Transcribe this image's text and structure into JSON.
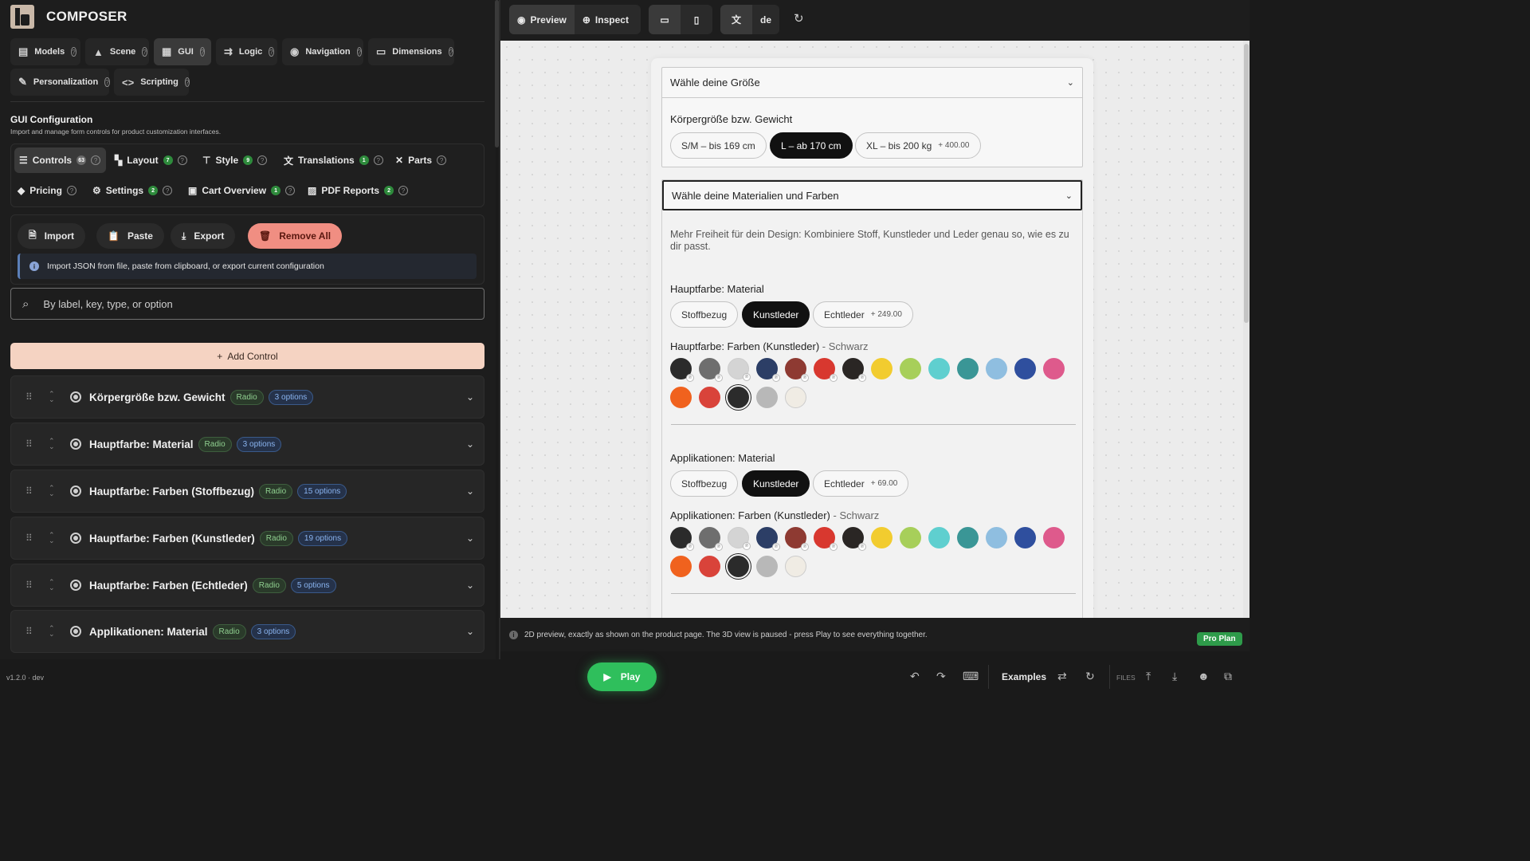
{
  "app": {
    "title": "COMPOSER",
    "version": "v1.2.0 · dev"
  },
  "main_tabs": [
    {
      "label": "Models",
      "icon": "database-icon"
    },
    {
      "label": "Scene",
      "icon": "mountain-icon"
    },
    {
      "label": "GUI",
      "icon": "grid-icon",
      "active": true
    },
    {
      "label": "Logic",
      "icon": "logic-icon"
    },
    {
      "label": "Navigation",
      "icon": "compass-icon"
    },
    {
      "label": "Dimensions",
      "icon": "ruler-icon"
    },
    {
      "label": "Personalization",
      "icon": "brush-icon"
    },
    {
      "label": "Scripting",
      "icon": "code-icon"
    }
  ],
  "gui_config": {
    "title": "GUI Configuration",
    "subtitle": "Import and manage form controls for product customization interfaces."
  },
  "sub_tabs": [
    {
      "label": "Controls",
      "count": "63",
      "active": true
    },
    {
      "label": "Layout",
      "count": "7"
    },
    {
      "label": "Style",
      "count": "9"
    },
    {
      "label": "Translations",
      "count": "1"
    },
    {
      "label": "Parts",
      "count": ""
    },
    {
      "label": "Pricing",
      "count": ""
    },
    {
      "label": "Settings",
      "count": "2"
    },
    {
      "label": "Cart Overview",
      "count": "1"
    },
    {
      "label": "PDF Reports",
      "count": "2"
    }
  ],
  "toolbar": {
    "import_label": "Import",
    "paste_label": "Paste",
    "export_label": "Export",
    "remove_all_label": "Remove All",
    "info_text": "Import JSON from file, paste from clipboard, or export current configuration"
  },
  "search": {
    "placeholder": "By label, key, type, or option",
    "value": ""
  },
  "add_control_label": "Add Control",
  "controls": [
    {
      "title": "Körpergröße bzw. Gewicht",
      "type": "Radio",
      "options": "3 options"
    },
    {
      "title": "Hauptfarbe: Material",
      "type": "Radio",
      "options": "3 options"
    },
    {
      "title": "Hauptfarbe: Farben (Stoffbezug)",
      "type": "Radio",
      "options": "15 options"
    },
    {
      "title": "Hauptfarbe: Farben (Kunstleder)",
      "type": "Radio",
      "options": "19 options"
    },
    {
      "title": "Hauptfarbe: Farben (Echtleder)",
      "type": "Radio",
      "options": "5 options"
    },
    {
      "title": "Applikationen: Material",
      "type": "Radio",
      "options": "3 options"
    }
  ],
  "topbar": {
    "preview_label": "Preview",
    "inspect_label": "Inspect",
    "language": "de"
  },
  "preview": {
    "size_section": {
      "header": "Wähle deine Größe",
      "label": "Körpergröße bzw. Gewicht",
      "options": [
        {
          "label": "S/M – bis 169 cm",
          "price": "",
          "selected": false
        },
        {
          "label": "L – ab 170 cm",
          "price": "",
          "selected": true
        },
        {
          "label": "XL – bis 200 kg",
          "price": "+ 400.00",
          "selected": false
        }
      ]
    },
    "material_section": {
      "header": "Wähle deine Materialien und Farben",
      "description": "Mehr Freiheit für dein Design: Kombiniere Stoff, Kunstleder und Leder genau so, wie es zu dir passt.",
      "main_material_label": "Hauptfarbe: Material",
      "main_material_options": [
        {
          "label": "Stoffbezug",
          "price": "",
          "selected": false
        },
        {
          "label": "Kunstleder",
          "price": "",
          "selected": true
        },
        {
          "label": "Echtleder",
          "price": "+ 249.00",
          "selected": false
        }
      ],
      "main_colors_label": "Hauptfarbe: Farben (Kunstleder)",
      "main_colors_value": " - Schwarz",
      "app_material_label": "Applikationen: Material",
      "app_material_options": [
        {
          "label": "Stoffbezug",
          "price": "",
          "selected": false
        },
        {
          "label": "Kunstleder",
          "price": "",
          "selected": true
        },
        {
          "label": "Echtleder",
          "price": "+ 69.00",
          "selected": false
        }
      ],
      "app_colors_label": "Applikationen: Farben (Kunstleder)",
      "app_colors_value": " - Schwarz"
    },
    "swatch_colors": [
      "#2b2b2b",
      "#6e6e6e",
      "#d4d4d4",
      "#2c3e66",
      "#8e3a32",
      "#d8382f",
      "#2a2624",
      "#f2cc2f",
      "#a7cf5a",
      "#5fcfcf",
      "#3a9696",
      "#8fbee0",
      "#2f4f9e",
      "#de5a8c",
      "#f0621e",
      "#d9433a",
      "#2b2b2b",
      "#b8b8b8",
      "#f0ece4"
    ],
    "swatch_marked": [
      true,
      true,
      true,
      true,
      true,
      true,
      true,
      false,
      false,
      false,
      false,
      false,
      false,
      false,
      false,
      false,
      false,
      false,
      false
    ]
  },
  "status": {
    "text": "2D preview, exactly as shown on the product page. The 3D view is paused - press Play to see everything together.",
    "plan": "Pro Plan"
  },
  "bottom": {
    "play_label": "Play",
    "examples_label": "Examples",
    "files_label": "FILES"
  }
}
